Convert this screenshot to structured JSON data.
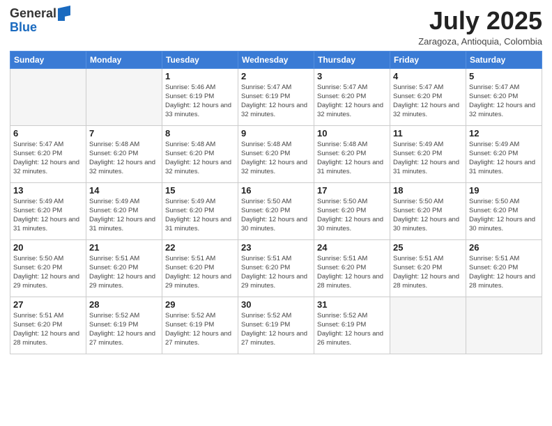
{
  "logo": {
    "general": "General",
    "blue": "Blue"
  },
  "title": {
    "month_year": "July 2025",
    "location": "Zaragoza, Antioquia, Colombia"
  },
  "days_of_week": [
    "Sunday",
    "Monday",
    "Tuesday",
    "Wednesday",
    "Thursday",
    "Friday",
    "Saturday"
  ],
  "weeks": [
    [
      {
        "day": "",
        "sunrise": "",
        "sunset": "",
        "daylight": ""
      },
      {
        "day": "",
        "sunrise": "",
        "sunset": "",
        "daylight": ""
      },
      {
        "day": "1",
        "sunrise": "Sunrise: 5:46 AM",
        "sunset": "Sunset: 6:19 PM",
        "daylight": "Daylight: 12 hours and 33 minutes."
      },
      {
        "day": "2",
        "sunrise": "Sunrise: 5:47 AM",
        "sunset": "Sunset: 6:19 PM",
        "daylight": "Daylight: 12 hours and 32 minutes."
      },
      {
        "day": "3",
        "sunrise": "Sunrise: 5:47 AM",
        "sunset": "Sunset: 6:20 PM",
        "daylight": "Daylight: 12 hours and 32 minutes."
      },
      {
        "day": "4",
        "sunrise": "Sunrise: 5:47 AM",
        "sunset": "Sunset: 6:20 PM",
        "daylight": "Daylight: 12 hours and 32 minutes."
      },
      {
        "day": "5",
        "sunrise": "Sunrise: 5:47 AM",
        "sunset": "Sunset: 6:20 PM",
        "daylight": "Daylight: 12 hours and 32 minutes."
      }
    ],
    [
      {
        "day": "6",
        "sunrise": "Sunrise: 5:47 AM",
        "sunset": "Sunset: 6:20 PM",
        "daylight": "Daylight: 12 hours and 32 minutes."
      },
      {
        "day": "7",
        "sunrise": "Sunrise: 5:48 AM",
        "sunset": "Sunset: 6:20 PM",
        "daylight": "Daylight: 12 hours and 32 minutes."
      },
      {
        "day": "8",
        "sunrise": "Sunrise: 5:48 AM",
        "sunset": "Sunset: 6:20 PM",
        "daylight": "Daylight: 12 hours and 32 minutes."
      },
      {
        "day": "9",
        "sunrise": "Sunrise: 5:48 AM",
        "sunset": "Sunset: 6:20 PM",
        "daylight": "Daylight: 12 hours and 32 minutes."
      },
      {
        "day": "10",
        "sunrise": "Sunrise: 5:48 AM",
        "sunset": "Sunset: 6:20 PM",
        "daylight": "Daylight: 12 hours and 31 minutes."
      },
      {
        "day": "11",
        "sunrise": "Sunrise: 5:49 AM",
        "sunset": "Sunset: 6:20 PM",
        "daylight": "Daylight: 12 hours and 31 minutes."
      },
      {
        "day": "12",
        "sunrise": "Sunrise: 5:49 AM",
        "sunset": "Sunset: 6:20 PM",
        "daylight": "Daylight: 12 hours and 31 minutes."
      }
    ],
    [
      {
        "day": "13",
        "sunrise": "Sunrise: 5:49 AM",
        "sunset": "Sunset: 6:20 PM",
        "daylight": "Daylight: 12 hours and 31 minutes."
      },
      {
        "day": "14",
        "sunrise": "Sunrise: 5:49 AM",
        "sunset": "Sunset: 6:20 PM",
        "daylight": "Daylight: 12 hours and 31 minutes."
      },
      {
        "day": "15",
        "sunrise": "Sunrise: 5:49 AM",
        "sunset": "Sunset: 6:20 PM",
        "daylight": "Daylight: 12 hours and 31 minutes."
      },
      {
        "day": "16",
        "sunrise": "Sunrise: 5:50 AM",
        "sunset": "Sunset: 6:20 PM",
        "daylight": "Daylight: 12 hours and 30 minutes."
      },
      {
        "day": "17",
        "sunrise": "Sunrise: 5:50 AM",
        "sunset": "Sunset: 6:20 PM",
        "daylight": "Daylight: 12 hours and 30 minutes."
      },
      {
        "day": "18",
        "sunrise": "Sunrise: 5:50 AM",
        "sunset": "Sunset: 6:20 PM",
        "daylight": "Daylight: 12 hours and 30 minutes."
      },
      {
        "day": "19",
        "sunrise": "Sunrise: 5:50 AM",
        "sunset": "Sunset: 6:20 PM",
        "daylight": "Daylight: 12 hours and 30 minutes."
      }
    ],
    [
      {
        "day": "20",
        "sunrise": "Sunrise: 5:50 AM",
        "sunset": "Sunset: 6:20 PM",
        "daylight": "Daylight: 12 hours and 29 minutes."
      },
      {
        "day": "21",
        "sunrise": "Sunrise: 5:51 AM",
        "sunset": "Sunset: 6:20 PM",
        "daylight": "Daylight: 12 hours and 29 minutes."
      },
      {
        "day": "22",
        "sunrise": "Sunrise: 5:51 AM",
        "sunset": "Sunset: 6:20 PM",
        "daylight": "Daylight: 12 hours and 29 minutes."
      },
      {
        "day": "23",
        "sunrise": "Sunrise: 5:51 AM",
        "sunset": "Sunset: 6:20 PM",
        "daylight": "Daylight: 12 hours and 29 minutes."
      },
      {
        "day": "24",
        "sunrise": "Sunrise: 5:51 AM",
        "sunset": "Sunset: 6:20 PM",
        "daylight": "Daylight: 12 hours and 28 minutes."
      },
      {
        "day": "25",
        "sunrise": "Sunrise: 5:51 AM",
        "sunset": "Sunset: 6:20 PM",
        "daylight": "Daylight: 12 hours and 28 minutes."
      },
      {
        "day": "26",
        "sunrise": "Sunrise: 5:51 AM",
        "sunset": "Sunset: 6:20 PM",
        "daylight": "Daylight: 12 hours and 28 minutes."
      }
    ],
    [
      {
        "day": "27",
        "sunrise": "Sunrise: 5:51 AM",
        "sunset": "Sunset: 6:20 PM",
        "daylight": "Daylight: 12 hours and 28 minutes."
      },
      {
        "day": "28",
        "sunrise": "Sunrise: 5:52 AM",
        "sunset": "Sunset: 6:19 PM",
        "daylight": "Daylight: 12 hours and 27 minutes."
      },
      {
        "day": "29",
        "sunrise": "Sunrise: 5:52 AM",
        "sunset": "Sunset: 6:19 PM",
        "daylight": "Daylight: 12 hours and 27 minutes."
      },
      {
        "day": "30",
        "sunrise": "Sunrise: 5:52 AM",
        "sunset": "Sunset: 6:19 PM",
        "daylight": "Daylight: 12 hours and 27 minutes."
      },
      {
        "day": "31",
        "sunrise": "Sunrise: 5:52 AM",
        "sunset": "Sunset: 6:19 PM",
        "daylight": "Daylight: 12 hours and 26 minutes."
      },
      {
        "day": "",
        "sunrise": "",
        "sunset": "",
        "daylight": ""
      },
      {
        "day": "",
        "sunrise": "",
        "sunset": "",
        "daylight": ""
      }
    ]
  ]
}
